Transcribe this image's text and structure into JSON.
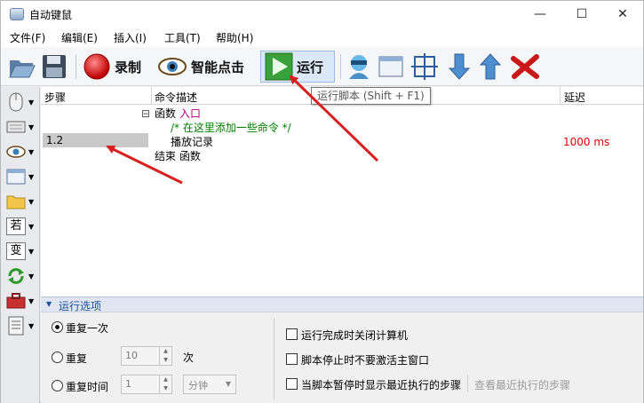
{
  "window": {
    "title": "自动键鼠",
    "minimize_glyph": "—",
    "maximize_glyph": "☐",
    "close_glyph": "✕"
  },
  "menu": [
    "文件(F)",
    "编辑(E)",
    "插入(I)",
    "工具(T)",
    "帮助(H)"
  ],
  "toolbar": {
    "record_label": "录制",
    "smart_click_label": "智能点击",
    "run_label": "运行",
    "run_tooltip": "运行脚本 (Shift + F1)"
  },
  "left_tools": {
    "if_label": "若",
    "var_label": "变"
  },
  "grid": {
    "columns": [
      "步骤",
      "命令描述",
      "延迟"
    ],
    "step_value": "1.2",
    "code": {
      "func_keyword": "函数",
      "func_name": "入口",
      "comment": "/* 在这里添加一些命令 */",
      "command": "播放记录",
      "delay": "1000 ms",
      "end_line": "结束 函数",
      "collapse_glyph": "⊟"
    }
  },
  "options": {
    "header": "运行选项",
    "repeat_once": "重复一次",
    "repeat": "重复",
    "repeat_count": "10",
    "times_unit": "次",
    "repeat_time": "重复时间",
    "time_value": "1",
    "time_unit": "分钟",
    "shutdown_after": "运行完成时关闭计算机",
    "no_activate": "脚本停止时不要激活主窗口",
    "show_recent": "当脚本暂停时显示最近执行的步骤",
    "view_recent": "查看最近执行的步骤"
  },
  "colors": {
    "accent": "#1f4fa0",
    "delay_red": "#e00000",
    "keyword_blue": "#0000c8",
    "comment_green": "#008000",
    "arrow_red": "#d92020"
  }
}
